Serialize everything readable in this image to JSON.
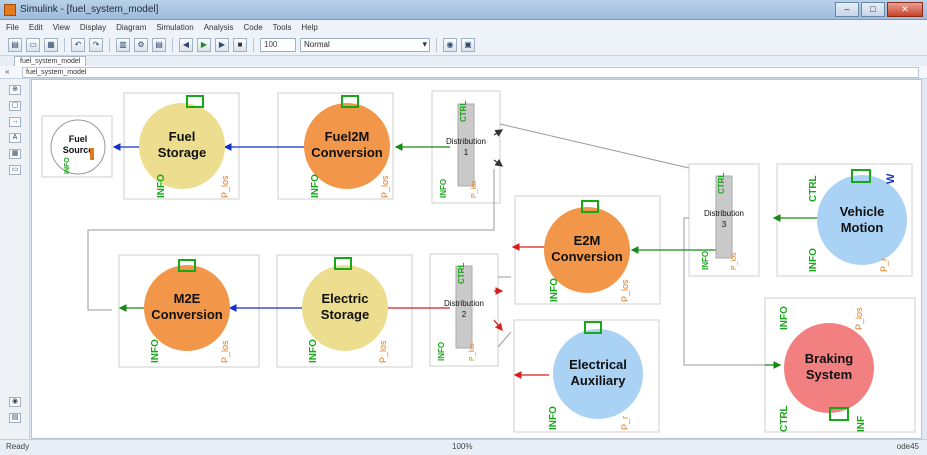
{
  "window": {
    "title": "Simulink - [fuel_system_model]",
    "controls": {
      "minimize": "–",
      "maximize": "□",
      "close": "✕"
    }
  },
  "menu": [
    "File",
    "Edit",
    "View",
    "Display",
    "Diagram",
    "Simulation",
    "Analysis",
    "Code",
    "Tools",
    "Help"
  ],
  "toolbar": {
    "sim_time": "100",
    "mode": "Normal"
  },
  "tab": "fuel_system_model",
  "address": "fuel_system_model",
  "status": {
    "left": "Ready",
    "center": "100%",
    "right": "ode45"
  },
  "blocks": {
    "fuel_source": {
      "line1": "Fuel",
      "line2": "Source",
      "info": "INFO"
    },
    "fuel_storage": {
      "line1": "Fuel",
      "line2": "Storage",
      "info": "INFO",
      "p_out": "P_los"
    },
    "fuel2m": {
      "line1": "Fuel2M",
      "line2": "Conversion",
      "info": "INFO",
      "p_out": "P_los"
    },
    "dist1": {
      "line1": "Distribution",
      "line2": "1",
      "ctrl": "CTRL",
      "info": "INFO",
      "p_los": "P_los"
    },
    "dist3": {
      "line1": "Distribution",
      "line2": "3",
      "ctrl": "CTRL",
      "info": "INFO",
      "p_los": "P_los"
    },
    "vehicle": {
      "line1": "Vehicle",
      "line2": "Motion",
      "ctrl": "CTRL",
      "info": "INFO",
      "p": "P_r",
      "w": "W"
    },
    "e2m": {
      "line1": "E2M",
      "line2": "Conversion",
      "info": "INFO",
      "p_out": "P_los"
    },
    "dist2": {
      "line1": "Distribution",
      "line2": "2",
      "ctrl": "CTRL",
      "info": "INFO",
      "p_los": "P_los"
    },
    "electric_storage": {
      "line1": "Electric",
      "line2": "Storage",
      "info": "INFO",
      "p_out": "P_los"
    },
    "m2e": {
      "line1": "M2E",
      "line2": "Conversion",
      "info": "INFO",
      "p_out": "P_los"
    },
    "aux": {
      "line1": "Electrical",
      "line2": "Auxiliary",
      "info": "INFO",
      "p": "P_r"
    },
    "braking": {
      "line1": "Braking",
      "line2": "System",
      "info": "INFO",
      "ctrl": "CTRL",
      "p": "P_los",
      "inf": "INF"
    }
  },
  "colors": {
    "yellow": "#ecdd8f",
    "orange": "#f2974a",
    "blue": "#a9d2f5",
    "pink": "#f28080",
    "port_green": "#19a71a",
    "port_orange": "#e07b1a",
    "signal_blue": "#1432c8",
    "signal_red": "#d71e1e",
    "signal_green": "#168a16",
    "line_gray": "#9a9a9a"
  }
}
